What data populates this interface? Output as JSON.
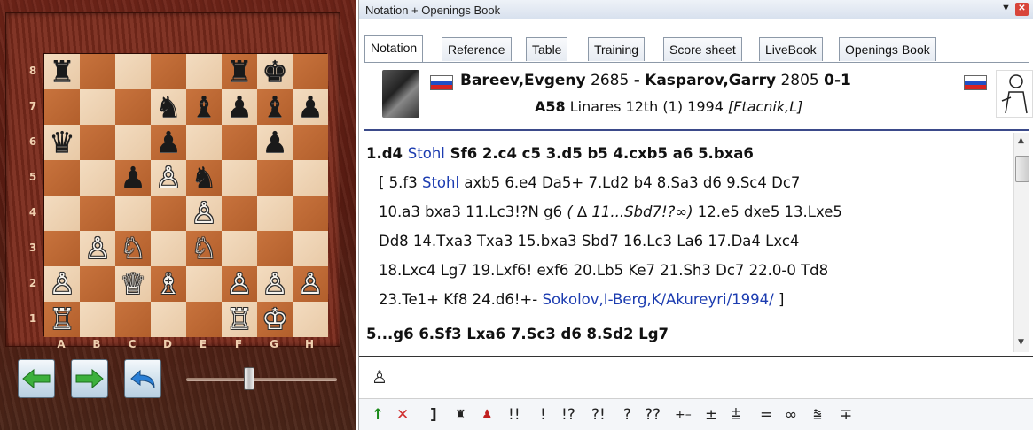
{
  "window": {
    "title": "Notation + Openings Book"
  },
  "tabs": [
    "Notation",
    "Reference",
    "Table",
    "Training",
    "Score sheet",
    "LiveBook",
    "Openings Book"
  ],
  "game": {
    "white_name": "Bareev,Evgeny",
    "white_elo": "2685",
    "separator": "-",
    "black_name": "Kasparov,Garry",
    "black_elo": "2805",
    "result": "0-1",
    "eco": "A58",
    "event": "Linares 12th (1) 1994",
    "annotator": "[Ftacnik,L]"
  },
  "colors": {
    "link_blue": "#1c3cb0",
    "flag_white": "#ffffff",
    "flag_blue": "#1f4fc6",
    "flag_red": "#d8231f"
  },
  "notation": {
    "line1_a": "1.d4",
    "line1_link": "Stohl",
    "line1_b": "Sf6  2.c4  c5  3.d5  b5  4.cxb5  a6  5.bxa6",
    "line2_a": "[ 5.f3",
    "line2_link": "Stohl",
    "line2_b": "axb5  6.e4  Da5+  7.Ld2  b4  8.Sa3  d6  9.Sc4  Dc7",
    "line3_a": "10.a3  bxa3  11.Lc3!?N  g6",
    "line3_italic": "( ∆ 11...Sbd7!?∞)",
    "line3_b": "12.e5  dxe5  13.Lxe5",
    "line4": "Dd8  14.Txa3  Txa3  15.bxa3  Sbd7  16.Lc3  La6  17.Da4  Lxc4",
    "line5": "18.Lxc4  Lg7  19.Lxf6!  exf6  20.Lb5  Ke7  21.Sh3  Dc7  22.0-0  Td8",
    "line6_a": "23.Te1+  Kf8  24.d6!+-",
    "line6_link": "Sokolov,I-Berg,K/Akureyri/1994/",
    "line6_b": "]",
    "line7": "5...g6  6.Sf3  Lxa6  7.Sc3  d6  8.Sd2  Lg7"
  },
  "board": {
    "files": [
      "A",
      "B",
      "C",
      "D",
      "E",
      "F",
      "G",
      "H"
    ],
    "ranks": [
      "8",
      "7",
      "6",
      "5",
      "4",
      "3",
      "2",
      "1"
    ],
    "pieces": [
      [
        "♜",
        "",
        "",
        "",
        "",
        "♜",
        "♚",
        ""
      ],
      [
        "",
        "",
        "",
        "♞",
        "♝",
        "♟",
        "♝",
        "♟"
      ],
      [
        "♛",
        "",
        "",
        "♟",
        "",
        "",
        "♟",
        ""
      ],
      [
        "",
        "",
        "♟",
        "♙",
        "♞",
        "",
        "",
        ""
      ],
      [
        "",
        "",
        "",
        "",
        "♙",
        "",
        "",
        ""
      ],
      [
        "",
        "♙",
        "♘",
        "",
        "♘",
        "",
        "",
        ""
      ],
      [
        "♙",
        "",
        "♕",
        "♗",
        "",
        "♙",
        "♙",
        "♙"
      ],
      [
        "♖",
        "",
        "",
        "",
        "",
        "♖",
        "♔",
        ""
      ]
    ],
    "piece_colors": [
      [
        "b",
        "",
        "",
        "",
        "",
        "b",
        "b",
        ""
      ],
      [
        "",
        "",
        "",
        "b",
        "b",
        "b",
        "b",
        "b"
      ],
      [
        "b",
        "",
        "",
        "b",
        "",
        "",
        "b",
        ""
      ],
      [
        "",
        "",
        "b",
        "w",
        "b",
        "",
        "",
        ""
      ],
      [
        "",
        "",
        "",
        "",
        "w",
        "",
        "",
        ""
      ],
      [
        "",
        "w",
        "w",
        "",
        "w",
        "",
        "",
        ""
      ],
      [
        "w",
        "",
        "w",
        "w",
        "",
        "w",
        "w",
        "w"
      ],
      [
        "w",
        "",
        "",
        "",
        "",
        "w",
        "w",
        ""
      ]
    ]
  },
  "navigation": {
    "back_icon": "arrow-left-icon",
    "forward_icon": "arrow-right-icon",
    "undo_icon": "undo-icon",
    "slider_icon": "speed-slider"
  },
  "input": {
    "pawn_symbol": "♙"
  },
  "symbols": {
    "up_arrow": "↑",
    "delete": "✕",
    "bracket": "]",
    "rook_move": "♜",
    "pawn_move": "♟",
    "items": [
      "!!",
      "!",
      "!?",
      "?!",
      "?",
      "??",
      "+–",
      "±",
      "⩲",
      "=",
      "∞",
      "⩰",
      "∓"
    ]
  }
}
